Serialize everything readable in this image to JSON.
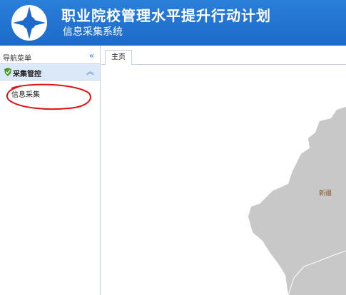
{
  "header": {
    "title": "职业院校管理水平提升行动计划",
    "subtitle": "信息采集系统",
    "logo_icon": "institution-logo-icon"
  },
  "sidebar": {
    "nav_title": "导航菜单",
    "collapse_icon": "double-chevron-left-icon",
    "group": {
      "label": "采集管控",
      "icon": "shield-leaf-icon",
      "collapse_icon": "double-chevron-up-icon"
    },
    "items": [
      {
        "label": "信息采集"
      }
    ]
  },
  "main": {
    "tabs": [
      {
        "label": "主页"
      }
    ],
    "map": {
      "region_label": "新疆"
    }
  },
  "colors": {
    "header": "#1c6ac9",
    "sidebar_group_bg": "#dbe8f8",
    "accent": "#3a7bd5",
    "annotation": "#e01414",
    "map_fill": "#c8c8c8"
  }
}
